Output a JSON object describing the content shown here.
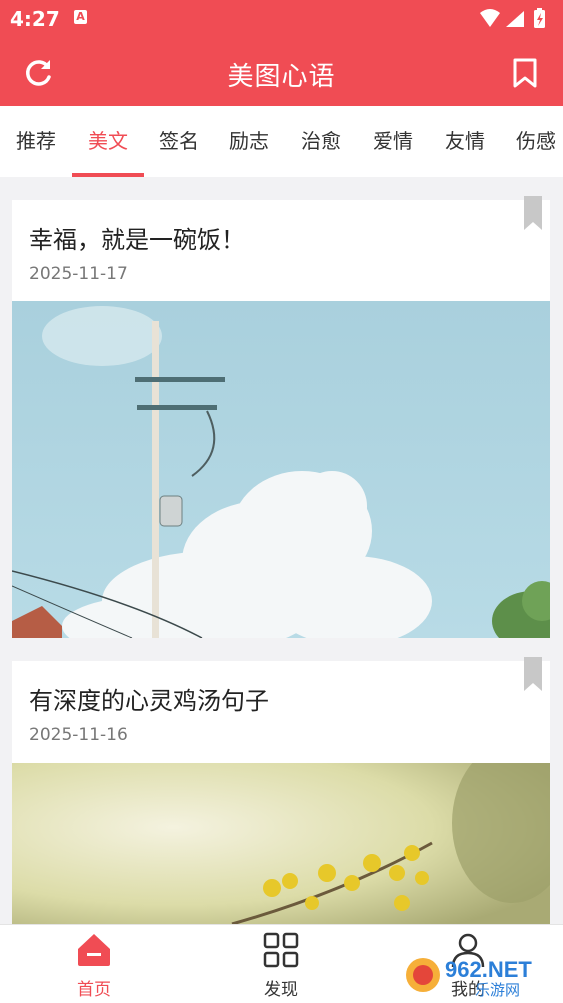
{
  "status": {
    "time": "4:27",
    "notification_glyph": "A"
  },
  "header": {
    "title": "美图心语"
  },
  "tabs": [
    {
      "label": "推荐"
    },
    {
      "label": "美文"
    },
    {
      "label": "签名"
    },
    {
      "label": "励志"
    },
    {
      "label": "治愈"
    },
    {
      "label": "爱情"
    },
    {
      "label": "友情"
    },
    {
      "label": "伤感"
    }
  ],
  "active_tab": "美文",
  "articles": [
    {
      "title": "幸福，就是一碗饭！",
      "date": "2025-11-17",
      "image_icon": "sky-utility-pole-image"
    },
    {
      "title": "有深度的心灵鸡汤句子",
      "date": "2025-11-16",
      "image_icon": "yellow-flowers-image"
    }
  ],
  "bottom_nav": [
    {
      "label": "首页",
      "icon": "home-icon"
    },
    {
      "label": "发现",
      "icon": "discover-icon"
    },
    {
      "label": "我的",
      "icon": "profile-icon"
    }
  ],
  "watermark": {
    "text": "962.NET",
    "subtext": "乐游网"
  },
  "colors": {
    "accent": "#f04c54",
    "background": "#f2f2f4"
  }
}
